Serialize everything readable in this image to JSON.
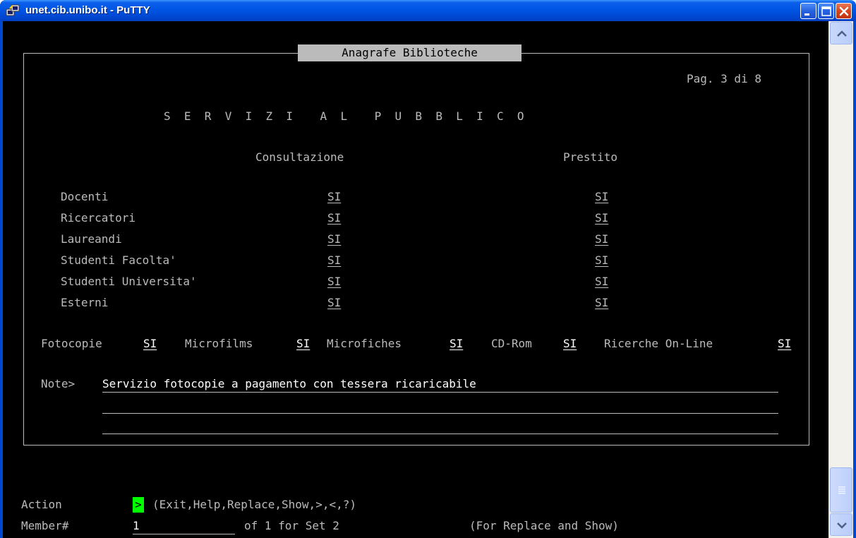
{
  "window": {
    "title": "unet.cib.unibo.it - PuTTY",
    "icon": "putty-icon",
    "controls": [
      "minimize-icon",
      "maximize-icon",
      "close-icon"
    ]
  },
  "terminal": {
    "box_title": "Anagrafe Biblioteche",
    "page_indicator": "Pag. 3 di 8",
    "section_title": "S  E  R  V  I  Z  I    A  L    P  U  B  B  L  I  C  O",
    "columns": {
      "consultazione": "Consultazione",
      "prestito": "Prestito"
    },
    "rows": [
      {
        "label": "Docenti",
        "consultazione": "SI",
        "prestito": "SI"
      },
      {
        "label": "Ricercatori",
        "consultazione": "SI",
        "prestito": "SI"
      },
      {
        "label": "Laureandi",
        "consultazione": "SI",
        "prestito": "SI"
      },
      {
        "label": "Studenti Facolta'",
        "consultazione": "SI",
        "prestito": "SI"
      },
      {
        "label": "Studenti Universita'",
        "consultazione": "SI",
        "prestito": "SI"
      },
      {
        "label": "Esterni",
        "consultazione": "SI",
        "prestito": "SI"
      }
    ],
    "services": [
      {
        "label": "Fotocopie",
        "value": "SI"
      },
      {
        "label": "Microfilms",
        "value": "SI"
      },
      {
        "label": "Microfiches",
        "value": "SI"
      },
      {
        "label": "CD-Rom",
        "value": "SI"
      },
      {
        "label": "Ricerche On-Line",
        "value": "SI"
      }
    ],
    "note": {
      "label": "Note>",
      "line1": "Servizio fotocopie a pagamento con tessera ricaricabile",
      "line2": "",
      "line3": ""
    },
    "action": {
      "label": "Action",
      "value": ">",
      "options": "(Exit,Help,Replace,Show,>,<,?)"
    },
    "member": {
      "label": "Member#",
      "value": "1",
      "of_text": "of 1 for Set 2",
      "hint": "(For Replace and Show)"
    }
  },
  "colors": {
    "terminal_bg": "#000000",
    "terminal_fg": "#bbbbbb",
    "cursor": "#00ff00",
    "titlebar": "#0055e5"
  }
}
